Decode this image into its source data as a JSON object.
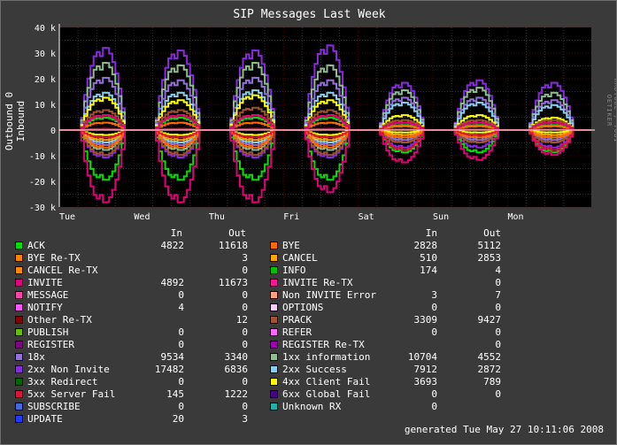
{
  "chart_data": {
    "type": "line",
    "title": "SIP Messages Last Week",
    "ylabel": "Outbound 0 Inbound",
    "watermark": "RRDTOOL / TOBI OETIKER",
    "ylim": [
      -30000,
      40000
    ],
    "y_ticks": [
      "40 k",
      "30 k",
      "20 k",
      "10 k",
      "0",
      "-10 k",
      "-20 k",
      "-30 k"
    ],
    "y_tick_values": [
      40000,
      30000,
      20000,
      10000,
      0,
      -10000,
      -20000,
      -30000
    ],
    "x_ticks": [
      "Tue",
      "Wed",
      "Thu",
      "Fri",
      "Sat",
      "Sun",
      "Mon"
    ],
    "grid": true,
    "legend_headers": {
      "in": "In",
      "out": "Out"
    },
    "series": [
      {
        "name": "ACK",
        "color": "#00e000",
        "in": "4822",
        "out": "11618"
      },
      {
        "name": "BYE",
        "color": "#ff6a00",
        "in": "2828",
        "out": "5112"
      },
      {
        "name": "BYE Re-TX",
        "color": "#ff7f00",
        "in": "",
        "out": "3"
      },
      {
        "name": "CANCEL",
        "color": "#ffa500",
        "in": "510",
        "out": "2853"
      },
      {
        "name": "CANCEL Re-TX",
        "color": "#ff8c00",
        "in": "",
        "out": "0"
      },
      {
        "name": "INFO",
        "color": "#00c000",
        "in": "174",
        "out": "4"
      },
      {
        "name": "INVITE",
        "color": "#e0007a",
        "in": "4892",
        "out": "11673"
      },
      {
        "name": "INVITE Re-TX",
        "color": "#ff1493",
        "in": "",
        "out": "0"
      },
      {
        "name": "MESSAGE",
        "color": "#ff44aa",
        "in": "0",
        "out": "0"
      },
      {
        "name": "Non INVITE Error",
        "color": "#ffa07a",
        "in": "3",
        "out": "7"
      },
      {
        "name": "NOTIFY",
        "color": "#ff55ff",
        "in": "4",
        "out": "0"
      },
      {
        "name": "OPTIONS",
        "color": "#ffccff",
        "in": "0",
        "out": "0"
      },
      {
        "name": "Other Re-TX",
        "color": "#800000",
        "in": "",
        "out": "12"
      },
      {
        "name": "PRACK",
        "color": "#a0522d",
        "in": "3309",
        "out": "9427"
      },
      {
        "name": "PUBLISH",
        "color": "#66bb00",
        "in": "0",
        "out": "0"
      },
      {
        "name": "REFER",
        "color": "#ff66ff",
        "in": "0",
        "out": "0"
      },
      {
        "name": "REGISTER",
        "color": "#800080",
        "in": "0",
        "out": "0"
      },
      {
        "name": "REGISTER Re-TX",
        "color": "#9900aa",
        "in": "",
        "out": "0"
      },
      {
        "name": "18x",
        "color": "#9370db",
        "in": "9534",
        "out": "3340"
      },
      {
        "name": "1xx information",
        "color": "#8fbc8f",
        "in": "10704",
        "out": "4552"
      },
      {
        "name": "2xx Non Invite",
        "color": "#8a2be2",
        "in": "17482",
        "out": "6836"
      },
      {
        "name": "2xx Success",
        "color": "#87ceeb",
        "in": "7912",
        "out": "2872"
      },
      {
        "name": "3xx Redirect",
        "color": "#006400",
        "in": "0",
        "out": "0"
      },
      {
        "name": "4xx Client Fail",
        "color": "#ffff00",
        "in": "3693",
        "out": "789"
      },
      {
        "name": "5xx Server Fail",
        "color": "#dc143c",
        "in": "145",
        "out": "1222"
      },
      {
        "name": "6xx Global Fail",
        "color": "#4b0082",
        "in": "0",
        "out": "0"
      },
      {
        "name": "SUBSCRIBE",
        "color": "#4169e1",
        "in": "0",
        "out": "0"
      },
      {
        "name": "Unknown RX",
        "color": "#20b2aa",
        "in": "0",
        "out": ""
      },
      {
        "name": "UPDATE",
        "color": "#1e3cff",
        "in": "20",
        "out": "3"
      }
    ],
    "plotted": [
      {
        "color": "#8a2be2",
        "in_peaks": [
          33000,
          32000,
          32000,
          34000,
          19000,
          20000,
          19000
        ],
        "out_peaks": [
          -11000,
          -11000,
          -11000,
          -11000,
          -7000,
          -7000,
          -7000
        ]
      },
      {
        "color": "#8fbc8f",
        "in_peaks": [
          27000,
          26000,
          27000,
          26000,
          16000,
          17000,
          15000
        ],
        "out_peaks": [
          -8000,
          -8000,
          -8000,
          -8000,
          -5000,
          -5000,
          -5000
        ]
      },
      {
        "color": "#9370db",
        "in_peaks": [
          21000,
          20000,
          21000,
          20000,
          13000,
          13000,
          12000
        ],
        "out_peaks": [
          -6000,
          -6000,
          -6000,
          -6000,
          -4000,
          -4000,
          -4000
        ]
      },
      {
        "color": "#87ceeb",
        "in_peaks": [
          15000,
          15000,
          16000,
          15000,
          11000,
          11000,
          10000
        ],
        "out_peaks": [
          -5000,
          -5000,
          -5000,
          -5000,
          -3000,
          -3000,
          -3000
        ]
      },
      {
        "color": "#ffff00",
        "in_peaks": [
          13000,
          12000,
          14000,
          12000,
          6000,
          6000,
          5000
        ],
        "out_peaks": [
          -2000,
          -2000,
          -2000,
          -2000,
          -1000,
          -1000,
          -1000
        ]
      },
      {
        "color": "#a0522d",
        "in_peaks": [
          8000,
          8000,
          9000,
          8000,
          4000,
          4000,
          4000
        ],
        "out_peaks": [
          -10000,
          -10000,
          -10000,
          -10000,
          -5000,
          -5000,
          -5000
        ]
      },
      {
        "color": "#ffa500",
        "in_peaks": [
          6000,
          6000,
          6000,
          6000,
          3000,
          3000,
          3000
        ],
        "out_peaks": [
          -4000,
          -4000,
          -4000,
          -4000,
          -2000,
          -2000,
          -2000
        ]
      },
      {
        "color": "#00e000",
        "in_peaks": [
          5000,
          5000,
          5000,
          5000,
          2000,
          2000,
          2000
        ],
        "out_peaks": [
          -20000,
          -20000,
          -20000,
          -20000,
          -9000,
          -9000,
          -9000
        ]
      },
      {
        "color": "#ff6a00",
        "in_peaks": [
          3000,
          3000,
          3000,
          3000,
          1500,
          1500,
          1500
        ],
        "out_peaks": [
          -7000,
          -7000,
          -7000,
          -7000,
          -3000,
          -3000,
          -3000
        ]
      },
      {
        "color": "#e0007a",
        "in_peaks": [
          6000,
          6000,
          6000,
          6000,
          3000,
          3000,
          3000
        ],
        "out_peaks": [
          -29000,
          -29000,
          -29000,
          -25000,
          -13000,
          -12000,
          -10000
        ]
      },
      {
        "color": "#dc143c",
        "in_peaks": [
          500,
          500,
          500,
          500,
          300,
          300,
          300
        ],
        "out_peaks": [
          -3000,
          -3000,
          -3000,
          -3000,
          -8000,
          -2000,
          -8000
        ]
      }
    ],
    "generated": "generated Tue May 27 10:11:06 2008"
  }
}
